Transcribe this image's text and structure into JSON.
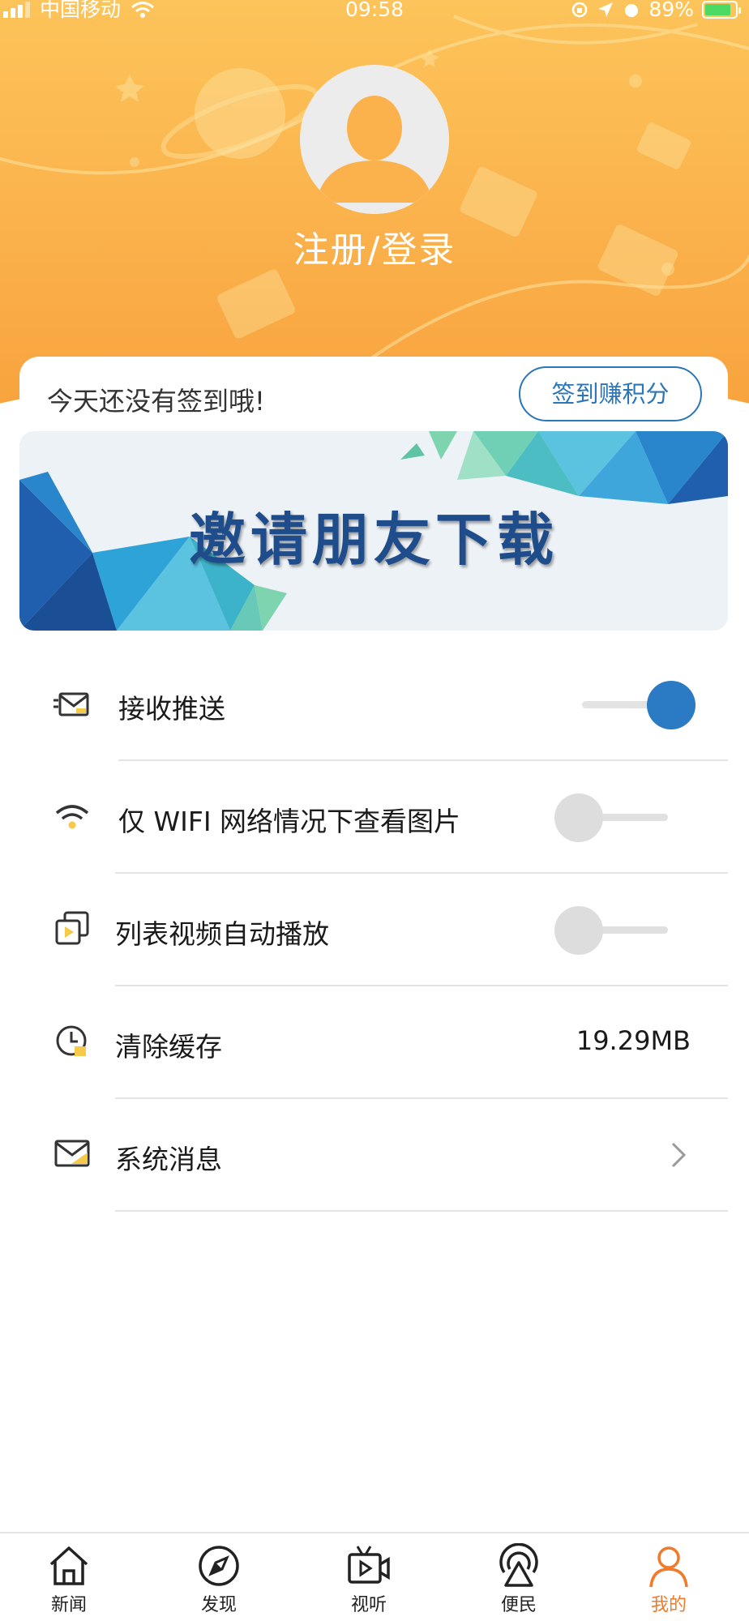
{
  "status_bar": {
    "carrier": "中国移动",
    "time": "09:58",
    "battery": "89%"
  },
  "profile": {
    "login_label": "注册/登录"
  },
  "signin": {
    "message": "今天还没有签到哦!",
    "button_label": "签到赚积分"
  },
  "banner": {
    "title": "邀请朋友下载"
  },
  "settings": {
    "push": {
      "label": "接收推送",
      "enabled": true
    },
    "wifi_images": {
      "label": "仅 WIFI 网络情况下查看图片",
      "enabled": false
    },
    "autoplay": {
      "label": "列表视频自动播放",
      "enabled": false
    },
    "clear_cache": {
      "label": "清除缓存",
      "value": "19.29MB"
    },
    "messages": {
      "label": "系统消息"
    }
  },
  "tabbar": {
    "tabs": [
      {
        "label": "新闻",
        "icon": "home-icon"
      },
      {
        "label": "发现",
        "icon": "compass-icon"
      },
      {
        "label": "视听",
        "icon": "video-icon"
      },
      {
        "label": "便民",
        "icon": "broadcast-icon"
      },
      {
        "label": "我的",
        "icon": "person-icon",
        "active": true
      }
    ]
  },
  "colors": {
    "header_orange": "#fbb24c",
    "accent_blue": "#2a7bc4",
    "active_tab": "#f27a2b"
  }
}
